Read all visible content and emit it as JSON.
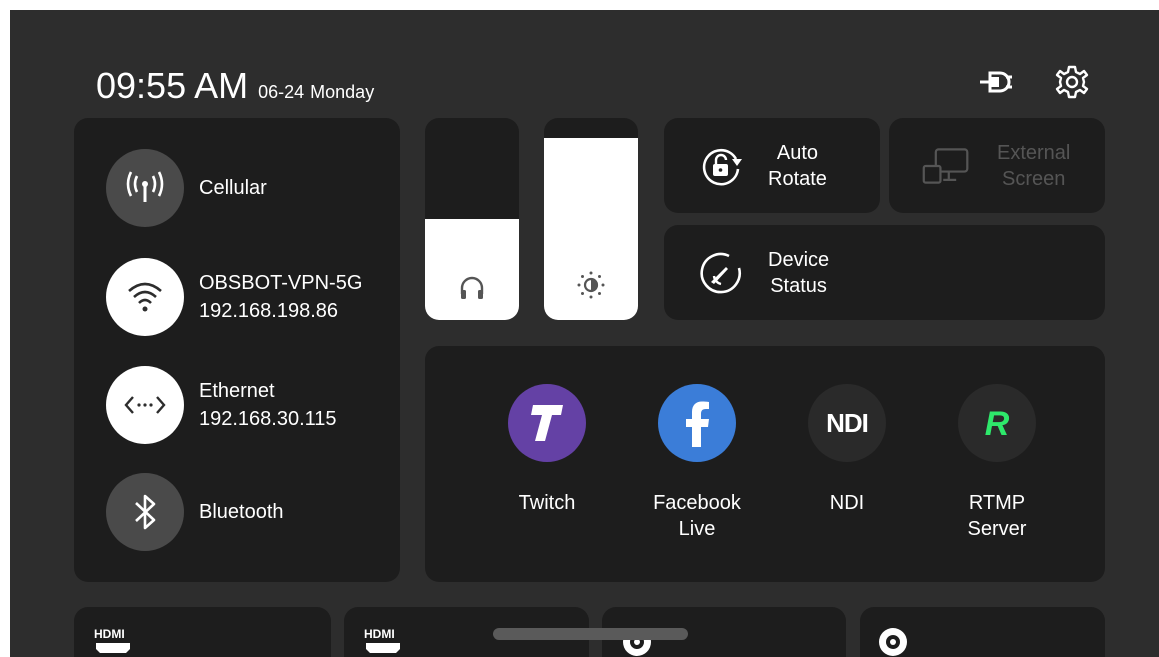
{
  "status": {
    "time": "09:55 AM",
    "date": "06-24",
    "day": "Monday"
  },
  "top_icons": [
    "power-plug-icon",
    "gear-icon"
  ],
  "network": {
    "items": [
      {
        "name": "Cellular",
        "detail": "",
        "icon": "cellular-antenna-icon",
        "active": false
      },
      {
        "name": "OBSBOT-VPN-5G",
        "detail": "192.168.198.86",
        "icon": "wifi-icon",
        "active": true
      },
      {
        "name": "Ethernet",
        "detail": "192.168.30.115",
        "icon": "ethernet-icon",
        "active": true
      },
      {
        "name": "Bluetooth",
        "detail": "",
        "icon": "bluetooth-icon",
        "active": false
      }
    ]
  },
  "sliders": {
    "volume": {
      "icon": "headphones-icon",
      "level": 0.5
    },
    "brightness": {
      "icon": "brightness-icon",
      "level": 0.9
    }
  },
  "tiles": {
    "auto_rotate": {
      "line1": "Auto",
      "line2": "Rotate",
      "icon": "auto-rotate-icon"
    },
    "external_screen": {
      "line1": "External",
      "line2": "Screen",
      "icon": "external-screen-icon",
      "enabled": false
    },
    "device_status": {
      "line1": "Device",
      "line2": "Status",
      "icon": "gauge-icon"
    }
  },
  "streaming": {
    "twitch": {
      "line1": "Twitch",
      "line2": "",
      "logo_letter": "T",
      "color": "#6441a5"
    },
    "facebook": {
      "line1": "Facebook",
      "line2": "Live",
      "logo_letter": "f",
      "color": "#3b7dd8"
    },
    "ndi": {
      "line1": "NDI",
      "line2": "",
      "logo_letter": "NDI",
      "color": "#2a2a2a"
    },
    "rtmp": {
      "line1": "RTMP",
      "line2": "Server",
      "logo_letter": "R",
      "color": "#2a2a2a",
      "accent": "#2ee86b"
    }
  },
  "bottom_cards": {
    "card1": {
      "badge": "HDMI"
    },
    "card2": {
      "badge": "HDMI"
    },
    "card3": {
      "icon": "camera-target-icon"
    },
    "card4": {
      "icon": "camera-target-icon"
    }
  },
  "colors": {
    "background": "#2d2d2d",
    "panel": "#1d1d1d",
    "accent_white": "#ffffff"
  }
}
